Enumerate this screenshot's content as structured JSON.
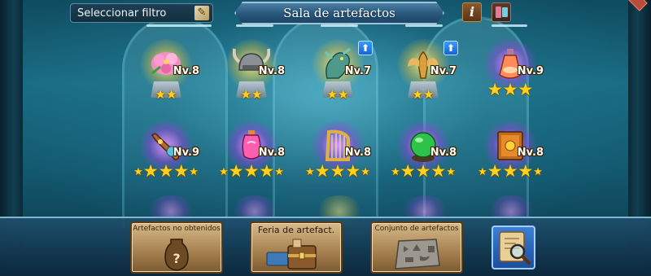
{
  "header": {
    "filter_label": "Seleccionar filtro",
    "title": "Sala de artefactos",
    "info_label": "i"
  },
  "colors": {
    "gold_glow": "#ffd21f",
    "purple_glow": "#b44be6",
    "title_banner": "#2b5a7f",
    "upgrade_arrow": "#1e6fe0"
  },
  "artifacts": [
    {
      "level": "Nv.8",
      "stars": 2,
      "rarity": "gold",
      "icon": "flower-bouquet-icon",
      "upgrade": false
    },
    {
      "level": "Nv.8",
      "stars": 2,
      "rarity": "gold",
      "icon": "horned-helmet-icon",
      "upgrade": false
    },
    {
      "level": "Nv.7",
      "stars": 2,
      "rarity": "gold",
      "icon": "dragon-statue-icon",
      "upgrade": true
    },
    {
      "level": "Nv.7",
      "stars": 2,
      "rarity": "gold",
      "icon": "winged-statue-icon",
      "upgrade": true
    },
    {
      "level": "Nv.9",
      "stars": 3,
      "rarity": "purple",
      "icon": "potion-flask-icon",
      "upgrade": false
    },
    {
      "level": "Nv.9",
      "stars": 5,
      "rarity": "purple",
      "icon": "horn-flute-icon",
      "upgrade": false
    },
    {
      "level": "Nv.8",
      "stars": 5,
      "rarity": "purple",
      "icon": "pink-potion-icon",
      "upgrade": false
    },
    {
      "level": "Nv.8",
      "stars": 5,
      "rarity": "purple",
      "icon": "golden-harp-icon",
      "upgrade": false
    },
    {
      "level": "Nv.8",
      "stars": 5,
      "rarity": "purple",
      "icon": "green-orb-icon",
      "upgrade": false
    },
    {
      "level": "Nv.8",
      "stars": 5,
      "rarity": "purple",
      "icon": "spell-book-icon",
      "upgrade": false
    }
  ],
  "bottom": {
    "not_obtained": "Artefactos no obtenidos",
    "fair": "Feria de artefact.",
    "set": "Conjunto de artefactos"
  }
}
